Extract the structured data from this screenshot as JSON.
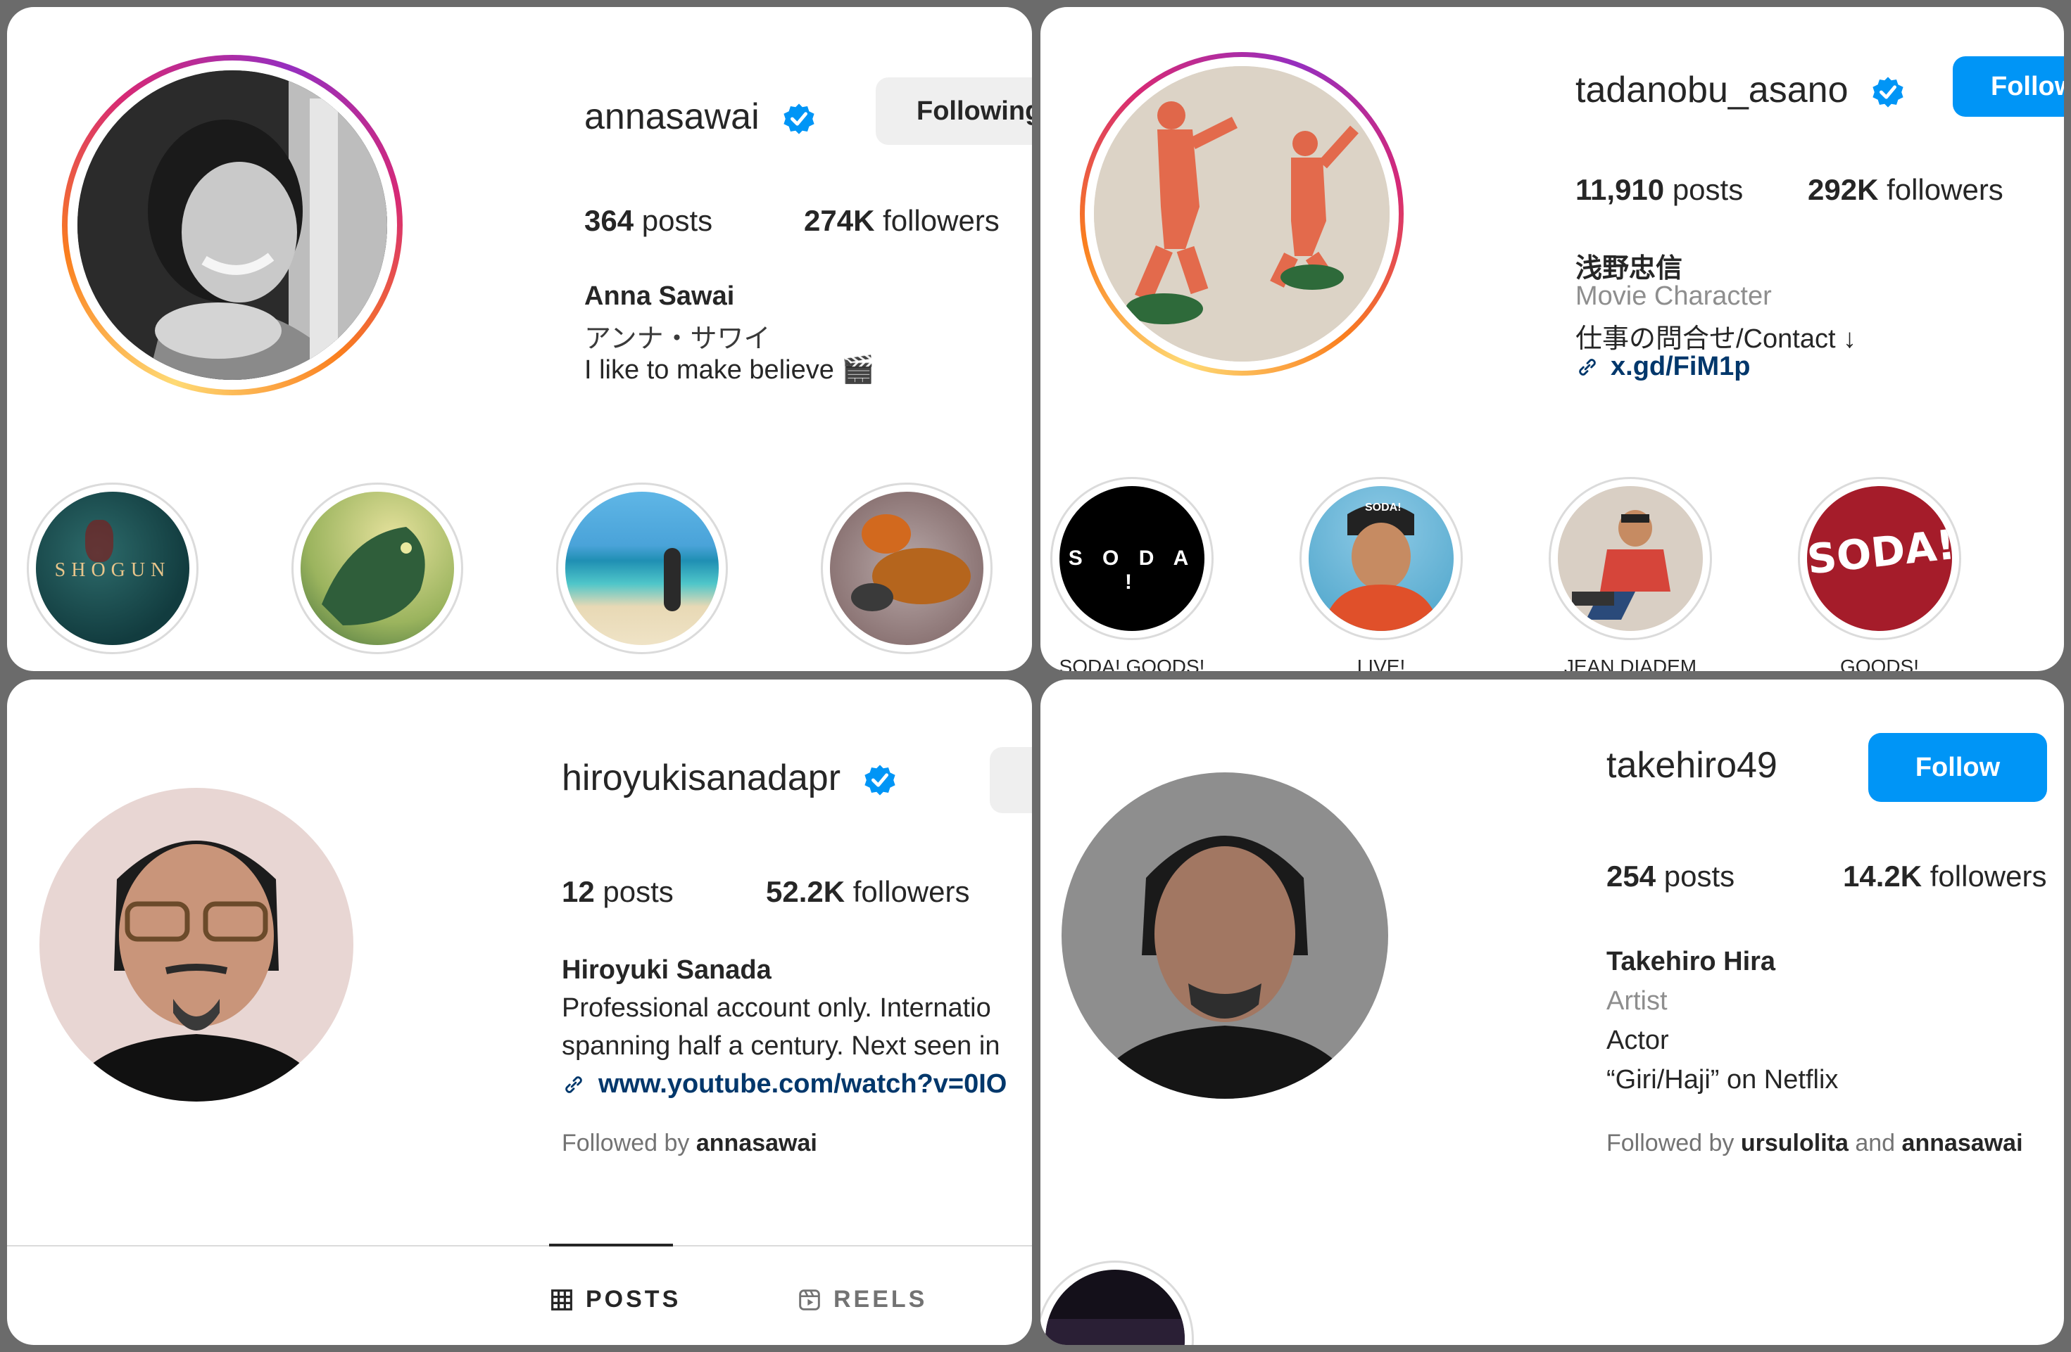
{
  "profiles": [
    {
      "username": "annasawai",
      "action_button": "Following",
      "posts_count": "364",
      "posts_label": "posts",
      "followers_count": "274K",
      "followers_label": "followers",
      "name": "Anna Sawai",
      "bio_lines": [
        "アンナ・サワイ",
        "I like to make believe 🎬"
      ],
      "highlights": [
        {
          "label": "",
          "overlay_text": "SHOGUN"
        },
        {
          "label": "",
          "overlay_text": ""
        },
        {
          "label": "",
          "overlay_text": ""
        },
        {
          "label": "",
          "overlay_text": ""
        }
      ]
    },
    {
      "username": "tadanobu_asano",
      "action_button": "Follow",
      "posts_count": "11,910",
      "posts_label": "posts",
      "followers_count": "292K",
      "followers_label": "followers",
      "name": "浅野忠信",
      "category": "Movie Character",
      "bio_lines": [
        "仕事の問合せ/Contact ↓"
      ],
      "link": "x.gd/FiM1p",
      "highlights": [
        {
          "label": "SODA! GOODS!",
          "overlay_text": "S O D A !"
        },
        {
          "label": "LIVE!",
          "overlay_text": "SODA!"
        },
        {
          "label": "JEAN DIADEM",
          "overlay_text": ""
        },
        {
          "label": "GOODS!",
          "overlay_text": "SODA!"
        }
      ]
    },
    {
      "username": "hiroyukisanadapr",
      "posts_count": "12",
      "posts_label": "posts",
      "followers_count": "52.2K",
      "followers_label": "followers",
      "name": "Hiroyuki Sanada",
      "bio_lines": [
        "Professional account only. Internatio",
        "spanning half a century. Next seen in"
      ],
      "link": "www.youtube.com/watch?v=0IO",
      "followed_by_prefix": "Followed by",
      "followed_by_users": "annasawai",
      "tabs": [
        "POSTS",
        "REELS"
      ]
    },
    {
      "username": "takehiro49",
      "action_button": "Follow",
      "posts_count": "254",
      "posts_label": "posts",
      "followers_count": "14.2K",
      "followers_label": "followers",
      "name": "Takehiro Hira",
      "category": "Artist",
      "bio_lines": [
        "Actor",
        "“Giri/Haji” on Netflix"
      ],
      "followed_by_prefix": "Followed by",
      "followed_by_user1": "ursulolita",
      "followed_by_and": "and",
      "followed_by_user2": "annasawai"
    }
  ],
  "colors": {
    "verified_blue": "#0095f6",
    "follow_blue": "#0095f6",
    "link_blue": "#00376b",
    "muted_grey": "#737373"
  }
}
